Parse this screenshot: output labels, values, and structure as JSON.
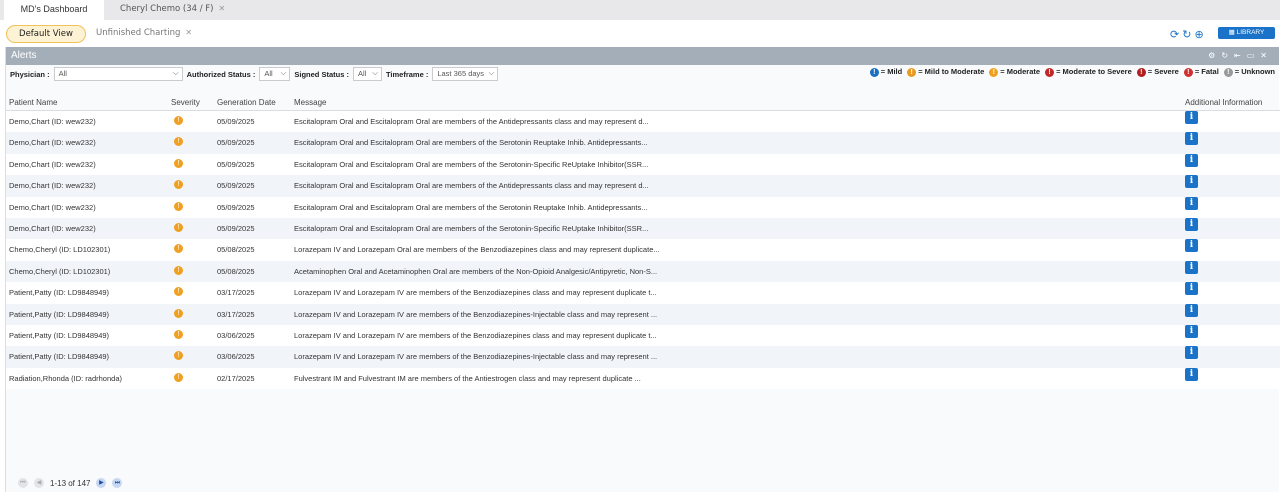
{
  "tabs": [
    {
      "label": "MD's Dashboard"
    },
    {
      "label": "Cheryl Chemo (34 / F)"
    }
  ],
  "views": {
    "default": "Default View",
    "unfinished": "Unfinished Charting"
  },
  "toolbar": {
    "library": "LIBRARY"
  },
  "panel": {
    "title": "Alerts"
  },
  "filters": {
    "physician_label": "Physician :",
    "physician": "All",
    "auth_label": "Authorized Status :",
    "auth": "All",
    "signed_label": "Signed Status :",
    "signed": "All",
    "timeframe_label": "Timeframe :",
    "timeframe": "Last 365 days"
  },
  "legend": [
    {
      "label": "= Mild",
      "color": "#1a6fc0"
    },
    {
      "label": "= Mild to Moderate",
      "color": "#e89b20"
    },
    {
      "label": "= Moderate",
      "color": "#f0a020"
    },
    {
      "label": "= Moderate to Severe",
      "color": "#c0282a"
    },
    {
      "label": "= Severe",
      "color": "#b02020"
    },
    {
      "label": "= Fatal",
      "color": "#d03030"
    },
    {
      "label": "= Unknown",
      "color": "#999999"
    }
  ],
  "columns": {
    "name": "Patient Name",
    "severity": "Severity",
    "date": "Generation Date",
    "message": "Message",
    "info": "Additional Information"
  },
  "rows": [
    {
      "name": "Demo,Chart (ID: wew232)",
      "date": "05/09/2025",
      "message": "Escitalopram Oral and Escitalopram Oral are members of the Antidepressants class and may represent d..."
    },
    {
      "name": "Demo,Chart (ID: wew232)",
      "date": "05/09/2025",
      "message": "Escitalopram Oral and Escitalopram Oral are members of the Serotonin Reuptake Inhib. Antidepressants..."
    },
    {
      "name": "Demo,Chart (ID: wew232)",
      "date": "05/09/2025",
      "message": "Escitalopram Oral and Escitalopram Oral are members of the Serotonin-Specific ReUptake Inhibitor(SSR..."
    },
    {
      "name": "Demo,Chart (ID: wew232)",
      "date": "05/09/2025",
      "message": "Escitalopram Oral and Escitalopram Oral are members of the Antidepressants class and may represent d..."
    },
    {
      "name": "Demo,Chart (ID: wew232)",
      "date": "05/09/2025",
      "message": "Escitalopram Oral and Escitalopram Oral are members of the Serotonin Reuptake Inhib. Antidepressants..."
    },
    {
      "name": "Demo,Chart (ID: wew232)",
      "date": "05/09/2025",
      "message": "Escitalopram Oral and Escitalopram Oral are members of the Serotonin-Specific ReUptake Inhibitor(SSR..."
    },
    {
      "name": "Chemo,Cheryl (ID: LD102301)",
      "date": "05/08/2025",
      "message": "Lorazepam IV and Lorazepam Oral are members of the Benzodiazepines class and may represent duplicate..."
    },
    {
      "name": "Chemo,Cheryl (ID: LD102301)",
      "date": "05/08/2025",
      "message": "Acetaminophen Oral and Acetaminophen Oral are members of the Non-Opioid Analgesic/Antipyretic, Non-S..."
    },
    {
      "name": "Patient,Patty (ID: LD9848949)",
      "date": "03/17/2025",
      "message": "Lorazepam IV and Lorazepam IV are members of the Benzodiazepines class and may represent duplicate t..."
    },
    {
      "name": "Patient,Patty (ID: LD9848949)",
      "date": "03/17/2025",
      "message": "Lorazepam IV and Lorazepam IV are members of the Benzodiazepines-Injectable class and may represent ..."
    },
    {
      "name": "Patient,Patty (ID: LD9848949)",
      "date": "03/06/2025",
      "message": "Lorazepam IV and Lorazepam IV are members of the Benzodiazepines class and may represent duplicate t..."
    },
    {
      "name": "Patient,Patty (ID: LD9848949)",
      "date": "03/06/2025",
      "message": "Lorazepam IV and Lorazepam IV are members of the Benzodiazepines-Injectable class and may represent ..."
    },
    {
      "name": "Radiation,Rhonda (ID: radrhonda)",
      "date": "02/17/2025",
      "message": "Fulvestrant IM and Fulvestrant IM are members of the Antiestrogen class and may represent duplicate ..."
    }
  ],
  "severity_color": "#f0a020",
  "pager": {
    "text": "1-13 of 147"
  }
}
